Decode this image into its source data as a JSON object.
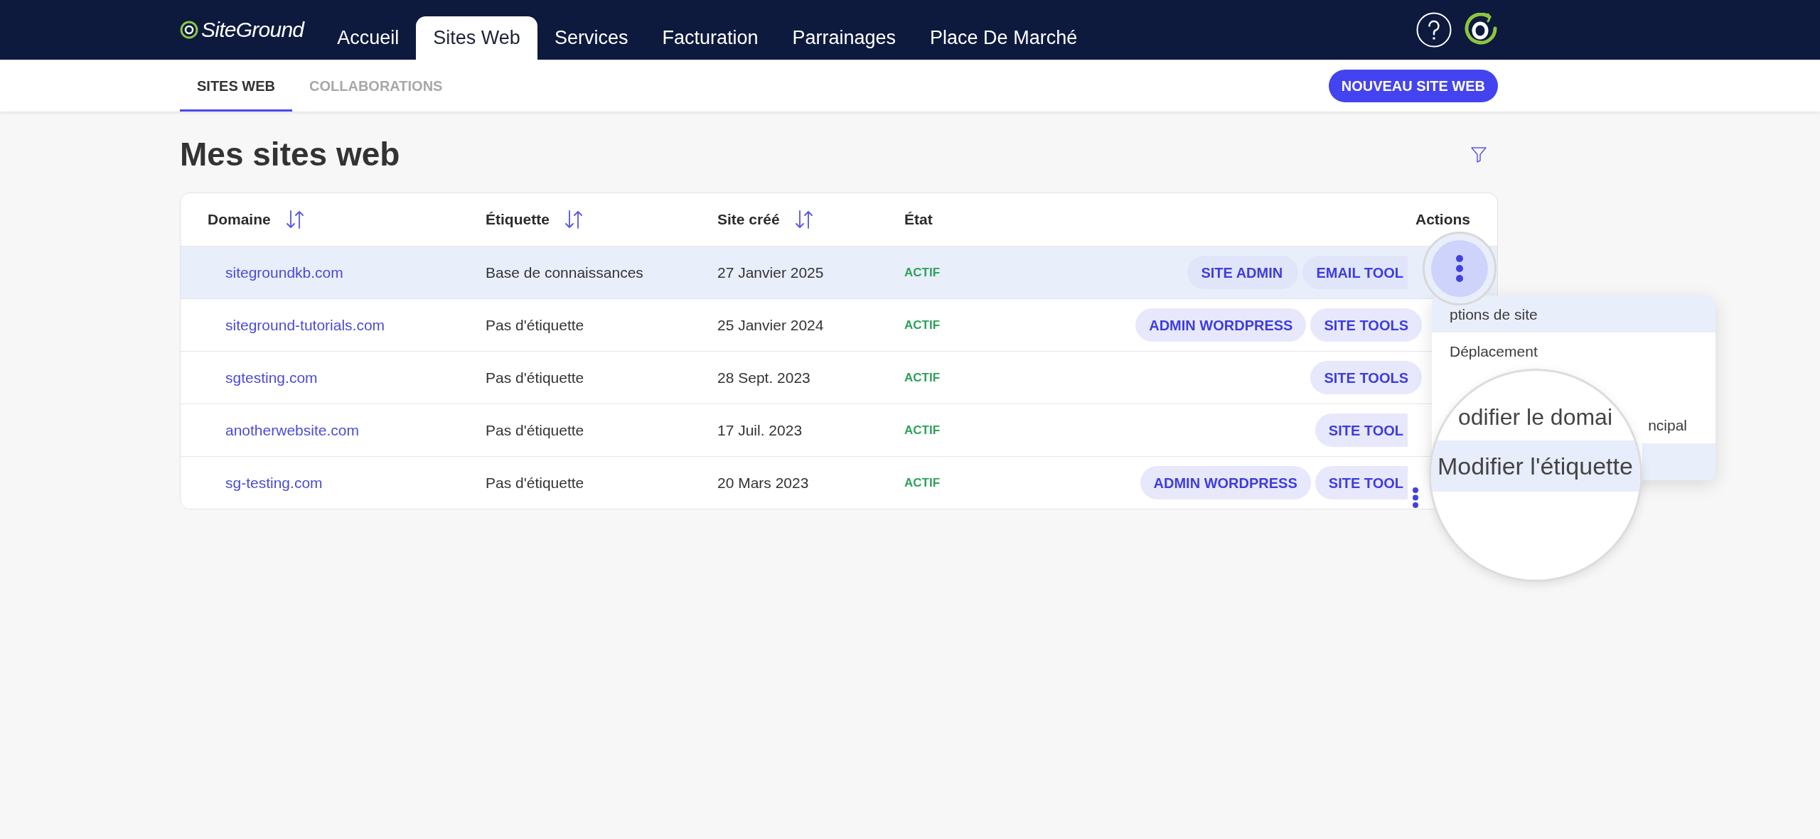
{
  "top_nav": {
    "logo": "SiteGround",
    "items": [
      {
        "label": "Accueil",
        "selected": false
      },
      {
        "label": "Sites Web",
        "selected": true
      },
      {
        "label": "Services",
        "selected": false
      },
      {
        "label": "Facturation",
        "selected": false
      },
      {
        "label": "Parrainages",
        "selected": false
      },
      {
        "label": "Place De Marché",
        "selected": false
      }
    ]
  },
  "sub_nav": {
    "tabs": [
      {
        "label": "SITES WEB",
        "selected": true
      },
      {
        "label": "COLLABORATIONS",
        "selected": false
      }
    ],
    "new_site_button": "NOUVEAU SITE WEB"
  },
  "page_title": "Mes sites web",
  "table": {
    "columns": [
      {
        "label": "Domaine",
        "sortable": true
      },
      {
        "label": "Étiquette",
        "sortable": true
      },
      {
        "label": "Site créé",
        "sortable": true
      },
      {
        "label": "État",
        "sortable": false
      },
      {
        "label": "Actions",
        "sortable": false
      }
    ],
    "rows": [
      {
        "domain": "sitegroundkb.com",
        "tag": "Base de connaissances",
        "created": "27 Janvier 2025",
        "status": "ACTIF",
        "selected": true,
        "actions": [
          {
            "label": "SITE ADMIN",
            "kind": "full"
          },
          {
            "label": "EMAIL TOOL",
            "kind": "cut"
          }
        ]
      },
      {
        "domain": "siteground-tutorials.com",
        "tag": "Pas d'étiquette",
        "created": "25 Janvier 2024",
        "status": "ACTIF",
        "selected": false,
        "actions": [
          {
            "label": "ADMIN WORDPRESS",
            "kind": "full"
          },
          {
            "label": "SITE TOOLS",
            "kind": "full"
          }
        ]
      },
      {
        "domain": "sgtesting.com",
        "tag": "Pas d'étiquette",
        "created": "28 Sept. 2023",
        "status": "ACTIF",
        "selected": false,
        "actions": [
          {
            "label": "SITE TOOLS",
            "kind": "full"
          }
        ]
      },
      {
        "domain": "anotherwebsite.com",
        "tag": "Pas d'étiquette",
        "created": "17 Juil. 2023",
        "status": "ACTIF",
        "selected": false,
        "actions": [
          {
            "label": "SITE TOOL",
            "kind": "cut"
          }
        ]
      },
      {
        "domain": "sg-testing.com",
        "tag": "Pas d'étiquette",
        "created": "20 Mars 2023",
        "status": "ACTIF",
        "selected": false,
        "actions": [
          {
            "label": "ADMIN WORDPRESS",
            "kind": "full"
          },
          {
            "label": "SITE TOOL",
            "kind": "cut"
          }
        ]
      }
    ]
  },
  "row_menu": {
    "items": [
      {
        "label": "ptions de site",
        "kind": "item",
        "selected": true
      },
      {
        "label": "Déplacement",
        "kind": "item",
        "selected": false
      },
      {
        "kind": "hidden"
      },
      {
        "label": "ncipal",
        "kind": "tail",
        "selected": false
      },
      {
        "kind": "tail",
        "selected": true
      }
    ]
  },
  "menu_lens": {
    "items": [
      {
        "label": "odifier le domai",
        "selected": false
      },
      {
        "label": "Modifier l'étiquette",
        "selected": true
      }
    ]
  }
}
